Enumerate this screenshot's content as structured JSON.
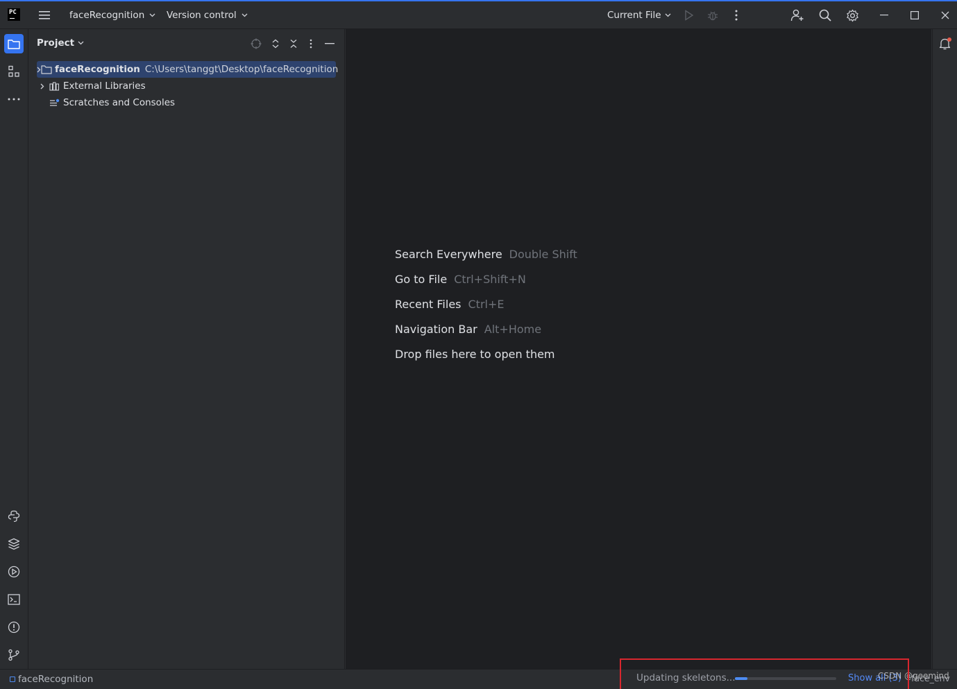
{
  "topbar": {
    "logo": "PC",
    "project_name": "faceRecognition",
    "vcs": "Version control",
    "run_config": "Current File",
    "icons": [
      "hamburger-icon",
      "run-icon",
      "debug-icon",
      "more-vertical-icon",
      "add-user-icon",
      "search-icon",
      "gear-icon",
      "minimize-icon",
      "maximize-icon",
      "close-icon"
    ]
  },
  "left_strip": {
    "icons": [
      "project-folder-icon",
      "structure-icon",
      "more-horizontal-icon",
      "python-console-icon",
      "python-packages-icon",
      "services-icon",
      "terminal-icon",
      "problems-icon",
      "git-icon"
    ]
  },
  "project_panel": {
    "title": "Project",
    "tree": [
      {
        "label": "faceRecognition",
        "path": "C:\\Users\\tanggt\\Desktop\\faceRecognition",
        "selected": true,
        "icon": "folder-icon"
      },
      {
        "label": "External Libraries",
        "path": "",
        "selected": false,
        "icon": "library-icon"
      },
      {
        "label": "Scratches and Consoles",
        "path": "",
        "selected": false,
        "icon": "scratches-icon"
      }
    ]
  },
  "editor": {
    "hints": [
      {
        "action": "Search Everywhere",
        "shortcut": "Double Shift"
      },
      {
        "action": "Go to File",
        "shortcut": "Ctrl+Shift+N"
      },
      {
        "action": "Recent Files",
        "shortcut": "Ctrl+E"
      },
      {
        "action": "Navigation Bar",
        "shortcut": "Alt+Home"
      },
      {
        "action": "Drop files here to open them",
        "shortcut": ""
      }
    ]
  },
  "statusbar": {
    "project": "faceRecognition",
    "progress_text": "Updating skeletons...",
    "progress": 0.12,
    "show_all": "Show all (3)",
    "face_env": "face_env",
    "watermark": "CSDN @geemind"
  },
  "colors": {
    "accent": "#3574f0",
    "selection": "#2e436e",
    "highlight_box": "#d9272e",
    "notification_dot": "#e55a4a"
  }
}
